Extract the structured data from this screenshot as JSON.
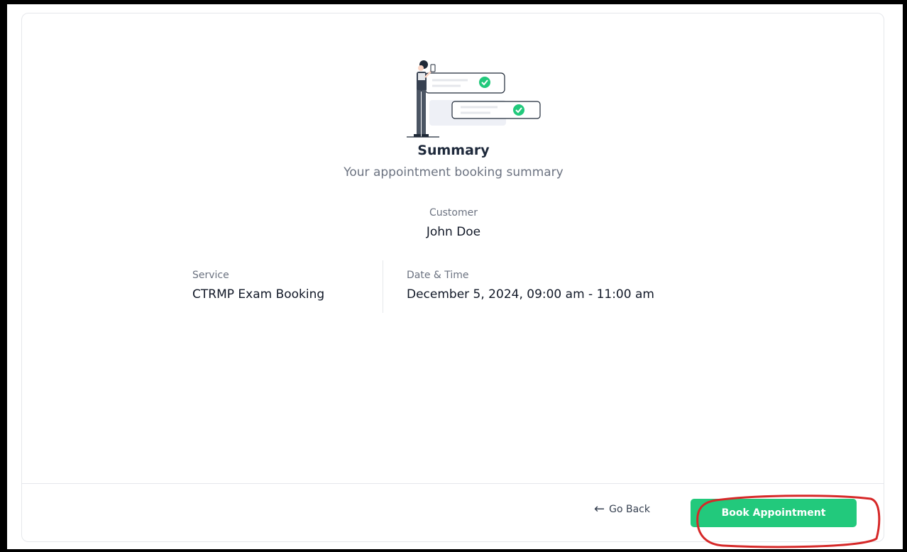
{
  "summary": {
    "title": "Summary",
    "subtitle": "Your appointment booking summary"
  },
  "customer": {
    "label": "Customer",
    "value": "John Doe"
  },
  "service": {
    "label": "Service",
    "value": "CTRMP Exam Booking"
  },
  "datetime": {
    "label": "Date & Time",
    "value": "December 5, 2024, 09:00 am - 11:00 am"
  },
  "footer": {
    "go_back_label": "Go Back",
    "go_back_icon": "arrow-left-icon",
    "book_label": "Book Appointment"
  },
  "colors": {
    "accent_green": "#22c97c",
    "annotation_red": "#d62828"
  }
}
